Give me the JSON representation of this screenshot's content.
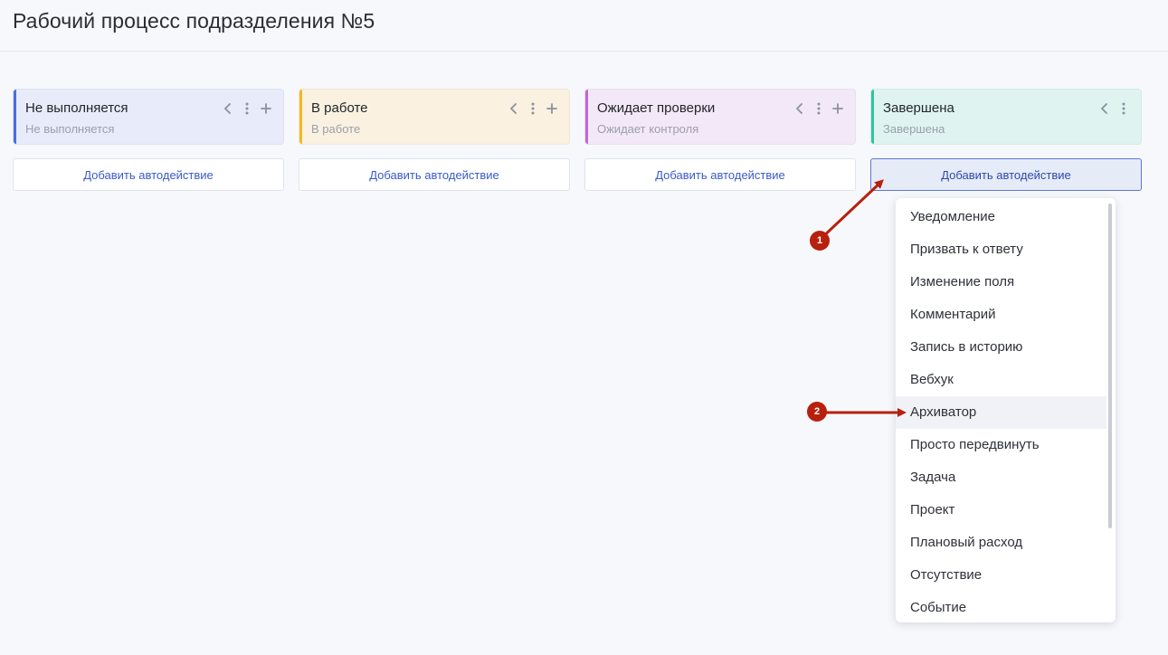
{
  "page": {
    "title": "Рабочий процесс подразделения №5"
  },
  "colors": {
    "background": "#f7f8fc",
    "link": "#3a5bc7",
    "annotation": "#b8200e"
  },
  "columns": [
    {
      "title": "Не выполняется",
      "subtitle": "Не выполняется",
      "accent": "#4a6de0",
      "bg": "#e8ebf9",
      "actions": [
        "chevron-left-icon",
        "more-vertical-icon",
        "plus-icon"
      ],
      "add_label": "Добавить автодействие"
    },
    {
      "title": "В работе",
      "subtitle": "В работе",
      "accent": "#f2b824",
      "bg": "#faf1e0",
      "actions": [
        "chevron-left-icon",
        "more-vertical-icon",
        "plus-icon"
      ],
      "add_label": "Добавить автодействие"
    },
    {
      "title": "Ожидает проверки",
      "subtitle": "Ожидает контроля",
      "accent": "#c267d6",
      "bg": "#f3e8f7",
      "actions": [
        "chevron-left-icon",
        "more-vertical-icon",
        "plus-icon"
      ],
      "add_label": "Добавить автодействие"
    },
    {
      "title": "Завершена",
      "subtitle": "Завершена",
      "accent": "#2ec4a0",
      "bg": "#dff4f1",
      "actions": [
        "chevron-left-icon",
        "more-vertical-icon"
      ],
      "add_label": "Добавить автодействие"
    }
  ],
  "dropdown": {
    "items": [
      "Уведомление",
      "Призвать к ответу",
      "Изменение поля",
      "Комментарий",
      "Запись в историю",
      "Вебхук",
      "Архиватор",
      "Просто передвинуть",
      "Задача",
      "Проект",
      "Плановый расход",
      "Отсутствие",
      "Событие"
    ],
    "highlighted": "Архиватор"
  },
  "annotations": [
    {
      "label": "1"
    },
    {
      "label": "2"
    }
  ]
}
